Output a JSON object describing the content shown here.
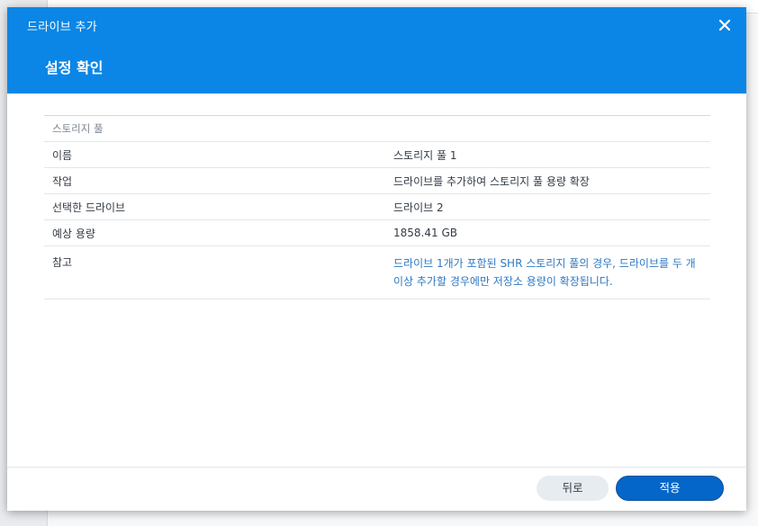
{
  "window": {
    "title": "드라이브 추가",
    "close_icon": "close-icon"
  },
  "step": {
    "title": "설정 확인"
  },
  "summary": {
    "group_label": "스토리지 풀",
    "rows": [
      {
        "key": "이름",
        "value": "스토리지 풀 1"
      },
      {
        "key": "작업",
        "value": "드라이브를 추가하여 스토리지 풀 용량 확장"
      },
      {
        "key": "선택한 드라이브",
        "value": "드라이브 2"
      },
      {
        "key": "예상 용량",
        "value": "1858.41 GB"
      }
    ],
    "note": {
      "key": "참고",
      "value": "드라이브 1개가 포함된 SHR 스토리지 풀의 경우, 드라이브를 두 개 이상 추가할 경우에만 저장소 용량이 확장됩니다."
    }
  },
  "footer": {
    "back_label": "뒤로",
    "apply_label": "적용"
  },
  "colors": {
    "header_bg": "#0b86e6",
    "primary_button": "#0466c8",
    "note_text": "#2f79c4"
  }
}
